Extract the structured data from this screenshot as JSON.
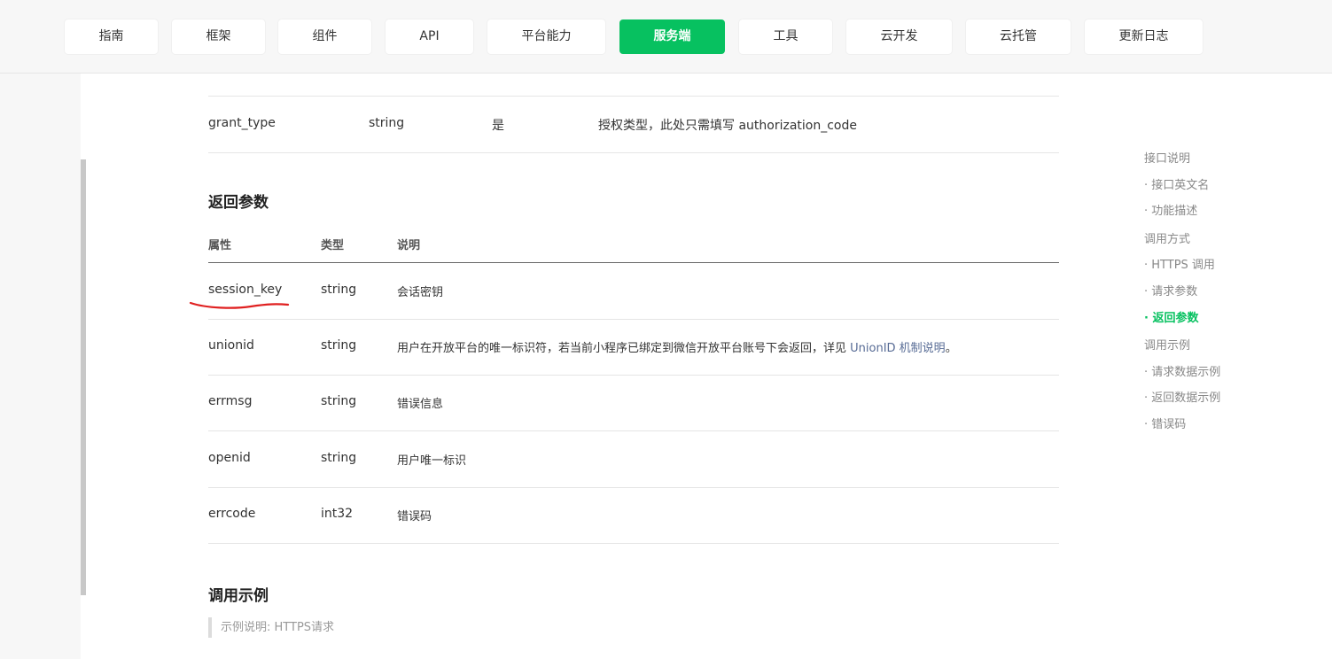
{
  "nav": {
    "items": [
      "指南",
      "框架",
      "组件",
      "API",
      "平台能力",
      "服务端",
      "工具",
      "云开发",
      "云托管",
      "更新日志"
    ],
    "active": "服务端",
    "accent_color": "#07c160"
  },
  "request_params": {
    "grant_type": {
      "name": "grant_type",
      "type": "string",
      "required": "是",
      "desc": "授权类型，此处只需填写 authorization_code"
    }
  },
  "return_section": {
    "title": "返回参数",
    "headers": [
      "属性",
      "类型",
      "说明"
    ],
    "rows": [
      {
        "name": "session_key",
        "type": "string",
        "desc": "会话密钥"
      },
      {
        "name": "unionid",
        "type": "string",
        "desc": "用户在开放平台的唯一标识符，若当前小程序已绑定到微信开放平台账号下会返回，详见 ",
        "link": "UnionID 机制说明",
        "tail": "。"
      },
      {
        "name": "errmsg",
        "type": "string",
        "desc": "错误信息"
      },
      {
        "name": "openid",
        "type": "string",
        "desc": "用户唯一标识"
      },
      {
        "name": "errcode",
        "type": "int32",
        "desc": "错误码"
      }
    ]
  },
  "example_section": {
    "title": "调用示例",
    "note": "示例说明: HTTPS请求"
  },
  "toc": {
    "items": [
      {
        "label": "接口说明",
        "level": 1
      },
      {
        "label": "· 接口英文名",
        "level": 2
      },
      {
        "label": "· 功能描述",
        "level": 2
      },
      {
        "label": "调用方式",
        "level": 1
      },
      {
        "label": "· HTTPS 调用",
        "level": 2
      },
      {
        "label": "· 请求参数",
        "level": 2
      },
      {
        "label": "· 返回参数",
        "level": 2,
        "active": true
      },
      {
        "label": "调用示例",
        "level": 1
      },
      {
        "label": "· 请求数据示例",
        "level": 2
      },
      {
        "label": "· 返回数据示例",
        "level": 2
      },
      {
        "label": "· 错误码",
        "level": 2
      }
    ]
  }
}
